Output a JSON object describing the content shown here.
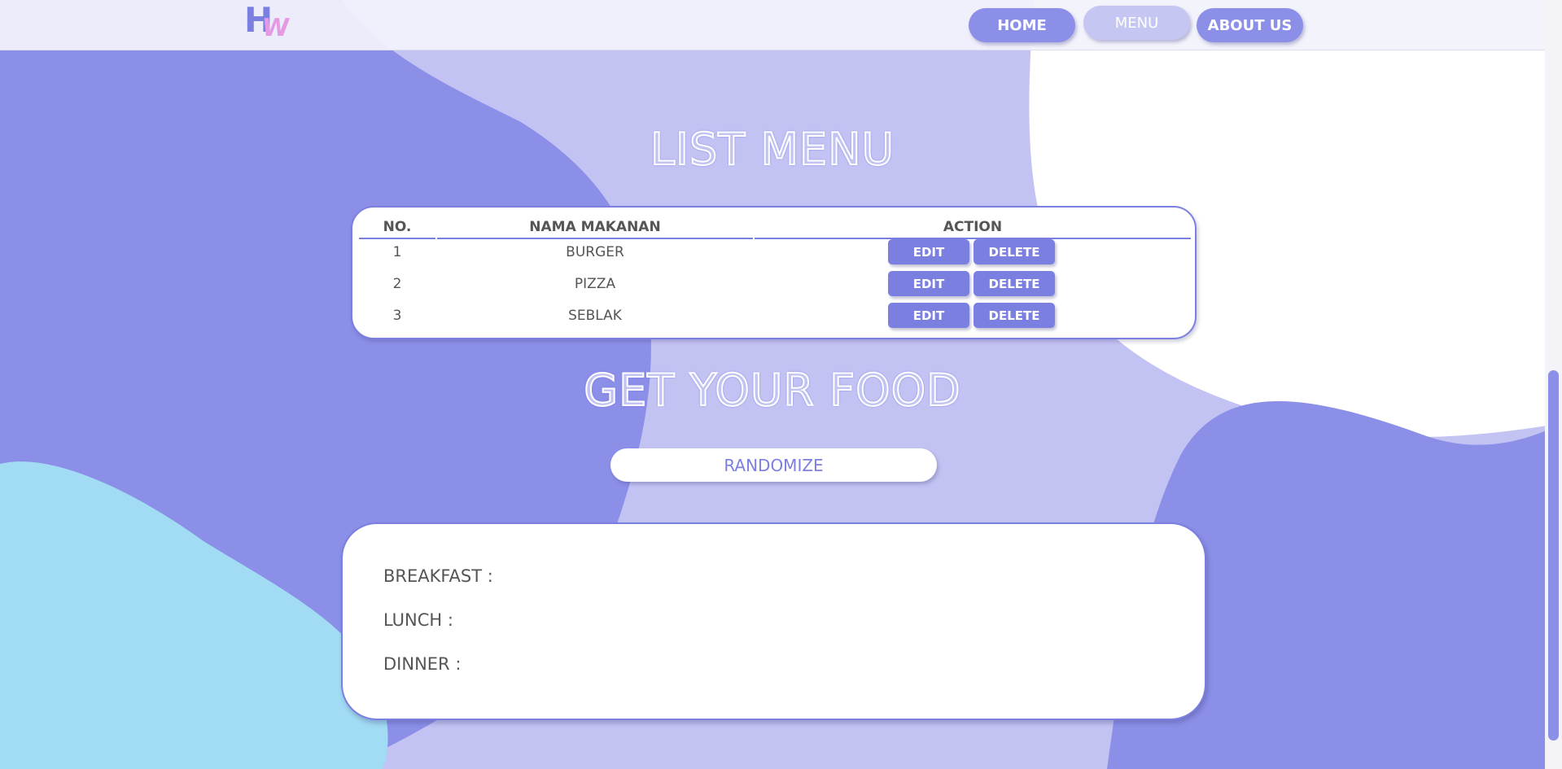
{
  "brand": {
    "logo_h": "H",
    "logo_w": "W"
  },
  "nav": {
    "home": "HOME",
    "menu": "MENU",
    "about": "ABOUT US"
  },
  "list_title": "LIST MENU",
  "table": {
    "headers": [
      "NO.",
      "NAMA MAKANAN",
      "ACTION"
    ],
    "rows": [
      {
        "no": "1",
        "name": "BURGER"
      },
      {
        "no": "2",
        "name": "PIZZA"
      },
      {
        "no": "3",
        "name": "SEBLAK"
      }
    ],
    "edit_label": "EDIT",
    "delete_label": "DELETE"
  },
  "food_title": "GET YOUR FOOD",
  "randomize_label": "RANDOMIZE",
  "meals": {
    "breakfast": {
      "label": "BREAKFAST :",
      "value": ""
    },
    "lunch": {
      "label": "LUNCH :",
      "value": ""
    },
    "dinner": {
      "label": "DINNER :",
      "value": ""
    }
  },
  "colors": {
    "accent": "#7b7fe0",
    "blob_dark": "#8b8fe8",
    "blob_light": "#c3c3f3",
    "blob_blue": "#a1dbf4",
    "logo_pink": "#e49ae2"
  }
}
